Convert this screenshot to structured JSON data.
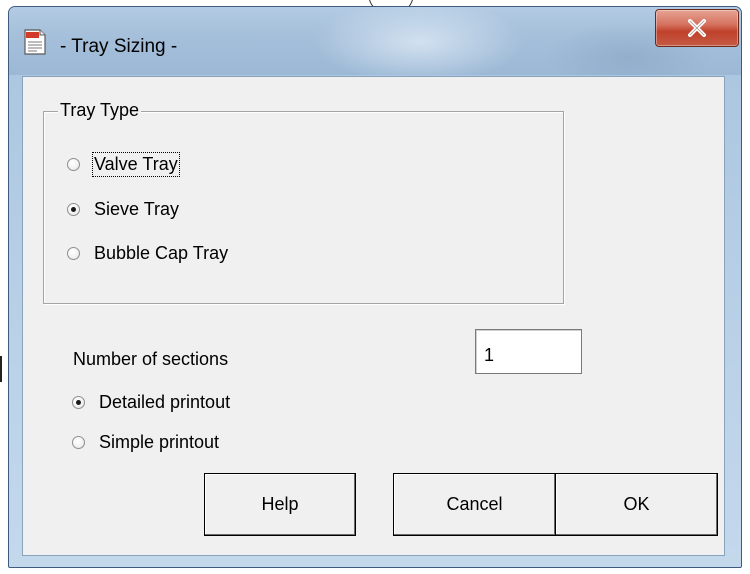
{
  "window": {
    "title": "- Tray Sizing -",
    "icon": "doc-icon"
  },
  "title_bar": {
    "close_icon": "close-icon"
  },
  "tray_type": {
    "label": "Tray Type",
    "options": [
      {
        "label": "Valve Tray",
        "checked": false
      },
      {
        "label": "Sieve Tray",
        "checked": true
      },
      {
        "label": "Bubble Cap Tray",
        "checked": false
      }
    ]
  },
  "sections": {
    "label": "Number of sections",
    "value": "1"
  },
  "printout": {
    "options": [
      {
        "label": "Detailed printout",
        "checked": true
      },
      {
        "label": "Simple printout",
        "checked": false
      }
    ]
  },
  "buttons": {
    "help": "Help",
    "cancel": "Cancel",
    "ok": "OK"
  }
}
